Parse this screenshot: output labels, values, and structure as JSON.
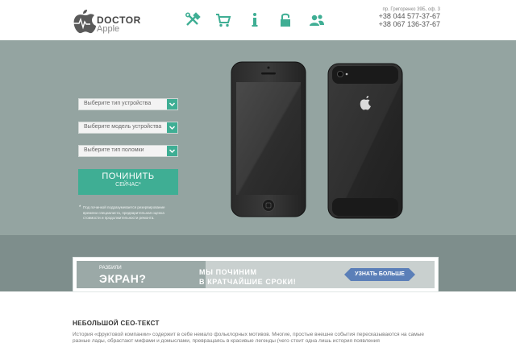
{
  "header": {
    "logo": {
      "title": "DOCTOR",
      "subtitle": "Apple"
    },
    "nav": [
      {
        "name": "tools-icon"
      },
      {
        "name": "cart-icon"
      },
      {
        "name": "info-icon"
      },
      {
        "name": "lock-icon"
      },
      {
        "name": "users-icon"
      }
    ],
    "contacts": {
      "address": "пр. Григоренко 39Б, оф. 3",
      "phone1": "+38 044 577-37-67",
      "phone2": "+38 067 136-37-67"
    }
  },
  "hero": {
    "selects": [
      {
        "value": "Выберите тип устройства"
      },
      {
        "value": "Выберите модель устройства"
      },
      {
        "value": "Выберите тип поломки"
      }
    ],
    "repair_button": {
      "main": "ПОЧИНИТЬ",
      "sub": "СЕЙЧАС*"
    },
    "note": {
      "asterisk": "*",
      "text": "Под починкой подразумевается резервирование времени специалиста, предварительная оценка стоимости и продолжительности ремонта."
    }
  },
  "banner": {
    "small": "РАЗБИЛИ",
    "big": "ЭКРАН?",
    "line1": "МЫ ПОЧИНИМ",
    "line2": "В КРАТЧАЙШИЕ СРОКИ!",
    "button": "УЗНАТЬ БОЛЬШЕ"
  },
  "seo": {
    "title": "НЕБОЛЬШОЙ СЕО-ТЕКСТ",
    "text": "История «фруктовой компании» содержит в себе немало фольклорных мотивов. Многие, простые внешне события пересказываются на самые разные лады, обрастают мифами и домыслами, превращаясь в красивые легенды (чего стоит одна лишь история появления"
  },
  "colors": {
    "accent": "#3fae94",
    "hero_bg": "#94a4a1",
    "band_bg": "#7e8e8c",
    "banner_button": "#5b7fb8"
  }
}
